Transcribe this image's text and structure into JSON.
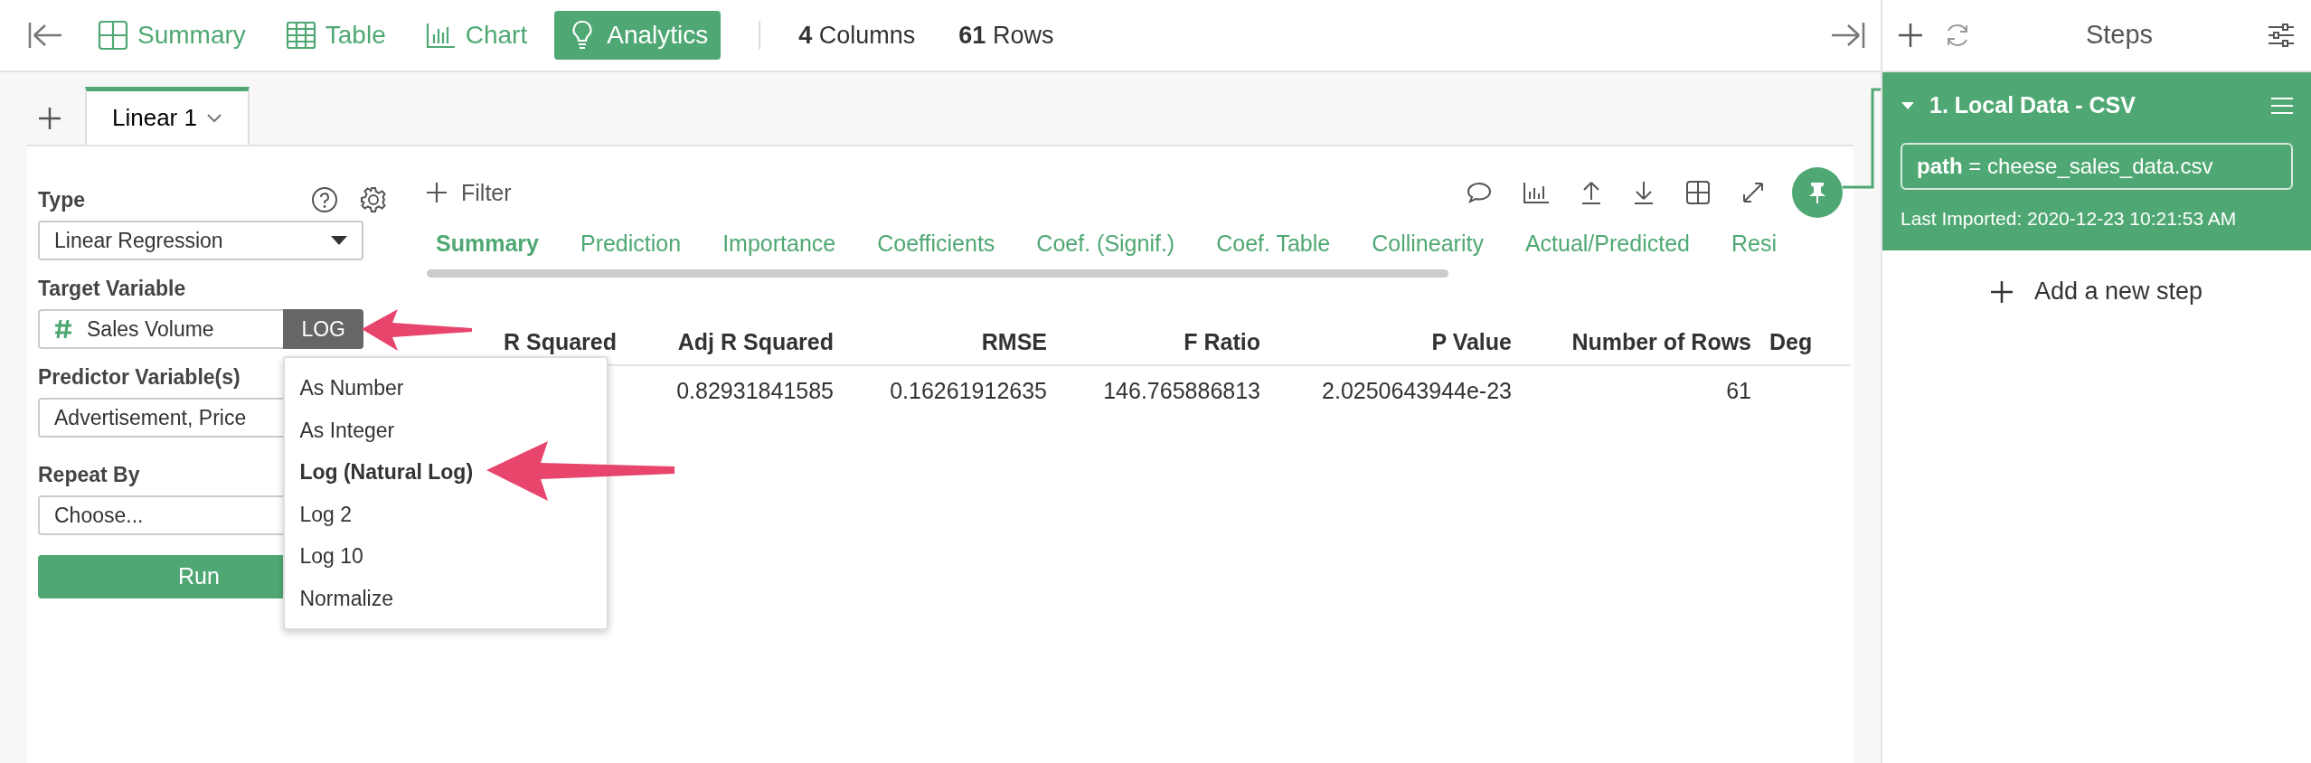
{
  "toolbar": {
    "nav": [
      {
        "label": "Summary",
        "selected": false
      },
      {
        "label": "Table",
        "selected": false
      },
      {
        "label": "Chart",
        "selected": false
      },
      {
        "label": "Analytics",
        "selected": true
      }
    ],
    "stats": [
      {
        "count": "4",
        "label": "Columns"
      },
      {
        "count": "61",
        "label": "Rows"
      }
    ]
  },
  "analysis_tabs": [
    {
      "label": "Linear 1",
      "selected": true
    }
  ],
  "form": {
    "type": {
      "label": "Type",
      "value": "Linear Regression"
    },
    "target": {
      "label": "Target Variable",
      "value": "Sales Volume",
      "transform": "LOG"
    },
    "predictors": {
      "label": "Predictor Variable(s)",
      "value": "Advertisement, Price"
    },
    "repeat_by": {
      "label": "Repeat By",
      "value": "Choose..."
    },
    "run_button": "Run"
  },
  "transform_menu": [
    {
      "label": "As Number",
      "selected": false
    },
    {
      "label": "As Integer",
      "selected": false
    },
    {
      "label": "Log (Natural Log)",
      "selected": true
    },
    {
      "label": "Log 2",
      "selected": false
    },
    {
      "label": "Log 10",
      "selected": false
    },
    {
      "label": "Normalize",
      "selected": false
    }
  ],
  "filter": "Filter",
  "result_tabs": [
    {
      "label": "Summary",
      "selected": true
    },
    {
      "label": "Prediction",
      "selected": false
    },
    {
      "label": "Importance",
      "selected": false
    },
    {
      "label": "Coefficients",
      "selected": false
    },
    {
      "label": "Coef. (Signif.)",
      "selected": false
    },
    {
      "label": "Coef. Table",
      "selected": false
    },
    {
      "label": "Collinearity",
      "selected": false
    },
    {
      "label": "Actual/Predicted",
      "selected": false
    },
    {
      "label": "Resi",
      "selected": false
    }
  ],
  "table": {
    "columns": [
      {
        "label": "R Squared"
      },
      {
        "label": "Adj R Squared",
        "value": "0.82931841585"
      },
      {
        "label": "RMSE",
        "value": "0.16261912635"
      },
      {
        "label": "F Ratio",
        "value": "146.765886813"
      },
      {
        "label": "P Value",
        "value": "2.0250643944e-23"
      },
      {
        "label": "Number of Rows",
        "value": "61"
      },
      {
        "label": "Deg"
      }
    ]
  },
  "steps": {
    "title": "Steps",
    "items": [
      {
        "title": "1. Local Data - CSV",
        "expanded": true,
        "param": "**path** = cheese_sales_data.csv",
        "note": "Last Imported: 2020-12-23 10:21:53 AM"
      }
    ],
    "add_step": "Add a new step"
  }
}
